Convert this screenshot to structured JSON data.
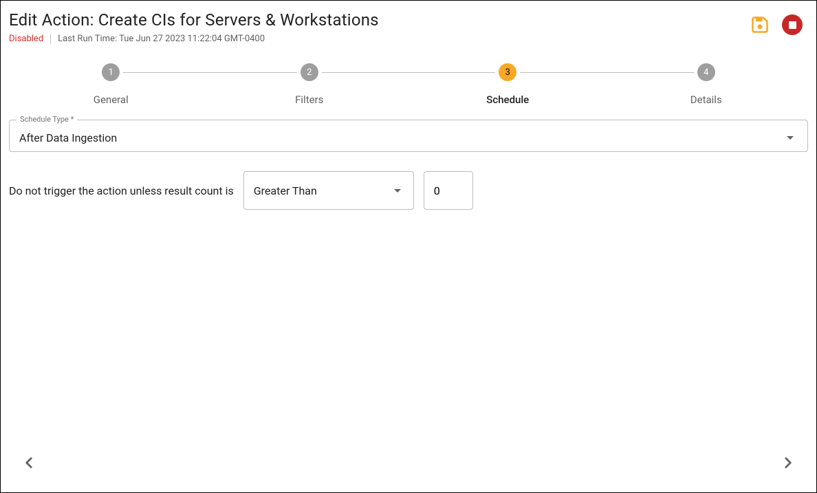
{
  "header": {
    "title": "Edit Action: Create CIs for Servers & Workstations",
    "status": "Disabled",
    "lastRun": "Last Run Time: Tue Jun 27 2023 11:22:04 GMT-0400"
  },
  "stepper": {
    "steps": [
      {
        "num": "1",
        "label": "General"
      },
      {
        "num": "2",
        "label": "Filters"
      },
      {
        "num": "3",
        "label": "Schedule"
      },
      {
        "num": "4",
        "label": "Details"
      }
    ],
    "activeIndex": 2
  },
  "form": {
    "scheduleType": {
      "legend": "Schedule Type *",
      "value": "After Data Ingestion"
    },
    "trigger": {
      "label": "Do not trigger the action unless result count is",
      "comparator": "Greater Than",
      "count": "0"
    }
  },
  "icons": {
    "save": "save-icon",
    "stop": "stop-icon",
    "prev": "chevron-left-icon",
    "next": "chevron-right-icon"
  },
  "colors": {
    "accent": "#f9a825",
    "danger": "#c62828",
    "muted": "#9e9e9e"
  }
}
